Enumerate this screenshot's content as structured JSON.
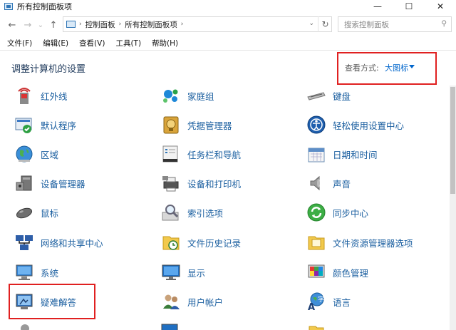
{
  "window": {
    "title": "所有控制面板项",
    "minimize": "—",
    "maximize": "☐",
    "close": "✕"
  },
  "nav": {
    "back": "←",
    "forward": "→",
    "recent": "⌄",
    "up": "↑",
    "breadcrumb": [
      "控制面板",
      "所有控制面板项"
    ],
    "refresh": "↻",
    "search_placeholder": "搜索控制面板",
    "search_icon": "⚲"
  },
  "menu": [
    "文件(F)",
    "编辑(E)",
    "查看(V)",
    "工具(T)",
    "帮助(H)"
  ],
  "header": {
    "title": "调整计算机的设置",
    "view_by_label": "查看方式:",
    "view_by_value": "大图标"
  },
  "items": [
    {
      "label": "红外线",
      "icon": "infrared-icon"
    },
    {
      "label": "家庭组",
      "icon": "homegroup-icon"
    },
    {
      "label": "键盘",
      "icon": "keyboard-icon"
    },
    {
      "label": "默认程序",
      "icon": "default-programs-icon"
    },
    {
      "label": "凭据管理器",
      "icon": "credential-manager-icon"
    },
    {
      "label": "轻松使用设置中心",
      "icon": "ease-of-access-icon"
    },
    {
      "label": "区域",
      "icon": "region-icon"
    },
    {
      "label": "任务栏和导航",
      "icon": "taskbar-icon"
    },
    {
      "label": "日期和时间",
      "icon": "date-time-icon"
    },
    {
      "label": "设备管理器",
      "icon": "device-manager-icon"
    },
    {
      "label": "设备和打印机",
      "icon": "devices-printers-icon"
    },
    {
      "label": "声音",
      "icon": "sound-icon"
    },
    {
      "label": "鼠标",
      "icon": "mouse-icon"
    },
    {
      "label": "索引选项",
      "icon": "indexing-icon"
    },
    {
      "label": "同步中心",
      "icon": "sync-center-icon"
    },
    {
      "label": "网络和共享中心",
      "icon": "network-sharing-icon"
    },
    {
      "label": "文件历史记录",
      "icon": "file-history-icon"
    },
    {
      "label": "文件资源管理器选项",
      "icon": "folder-options-icon"
    },
    {
      "label": "系统",
      "icon": "system-icon"
    },
    {
      "label": "显示",
      "icon": "display-icon"
    },
    {
      "label": "颜色管理",
      "icon": "color-management-icon"
    },
    {
      "label": "疑难解答",
      "icon": "troubleshooting-icon"
    },
    {
      "label": "用户帐户",
      "icon": "user-accounts-icon"
    },
    {
      "label": "语言",
      "icon": "language-icon"
    }
  ],
  "colors": {
    "link": "#1b5fa0",
    "highlight_box": "#e02020"
  }
}
